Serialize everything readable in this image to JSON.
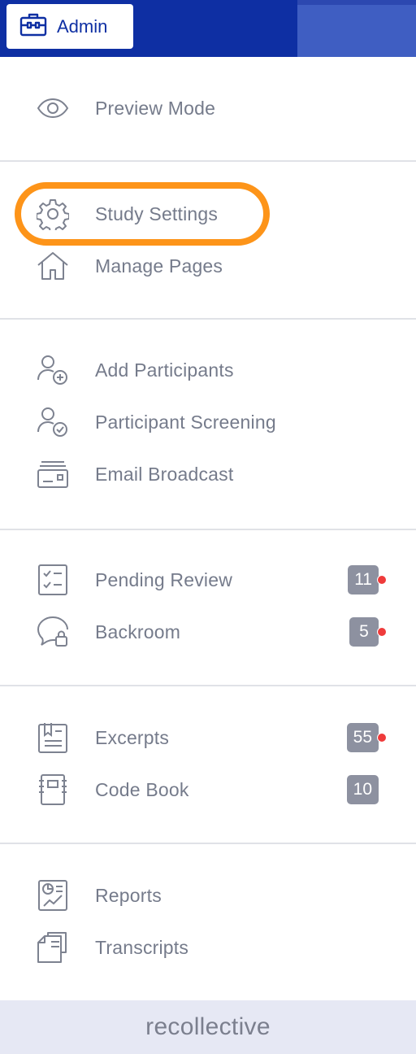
{
  "header": {
    "admin_label": "Admin",
    "colors": {
      "primary": "#0e2fa3",
      "highlight": "#fd9419",
      "badge": "#8d91a0",
      "alert_dot": "#ef3b3b"
    }
  },
  "sections": [
    {
      "items": [
        {
          "label": "Preview Mode",
          "icon": "eye-icon"
        }
      ]
    },
    {
      "items": [
        {
          "label": "Study Settings",
          "icon": "gear-icon",
          "highlighted": true
        },
        {
          "label": "Manage Pages",
          "icon": "home-icon"
        }
      ]
    },
    {
      "items": [
        {
          "label": "Add Participants",
          "icon": "user-plus-icon"
        },
        {
          "label": "Participant Screening",
          "icon": "user-check-icon"
        },
        {
          "label": "Email Broadcast",
          "icon": "mail-broadcast-icon"
        }
      ]
    },
    {
      "items": [
        {
          "label": "Pending Review",
          "icon": "checklist-icon",
          "badge": "11",
          "alert": true
        },
        {
          "label": "Backroom",
          "icon": "chat-lock-icon",
          "badge": "5",
          "alert": true
        }
      ]
    },
    {
      "items": [
        {
          "label": "Excerpts",
          "icon": "excerpt-icon",
          "badge": "55",
          "alert": true
        },
        {
          "label": "Code Book",
          "icon": "notebook-icon",
          "badge": "10",
          "alert": false
        }
      ]
    },
    {
      "items": [
        {
          "label": "Reports",
          "icon": "report-chart-icon"
        },
        {
          "label": "Transcripts",
          "icon": "documents-icon"
        }
      ]
    }
  ],
  "footer": {
    "logo_text": "recollective"
  }
}
